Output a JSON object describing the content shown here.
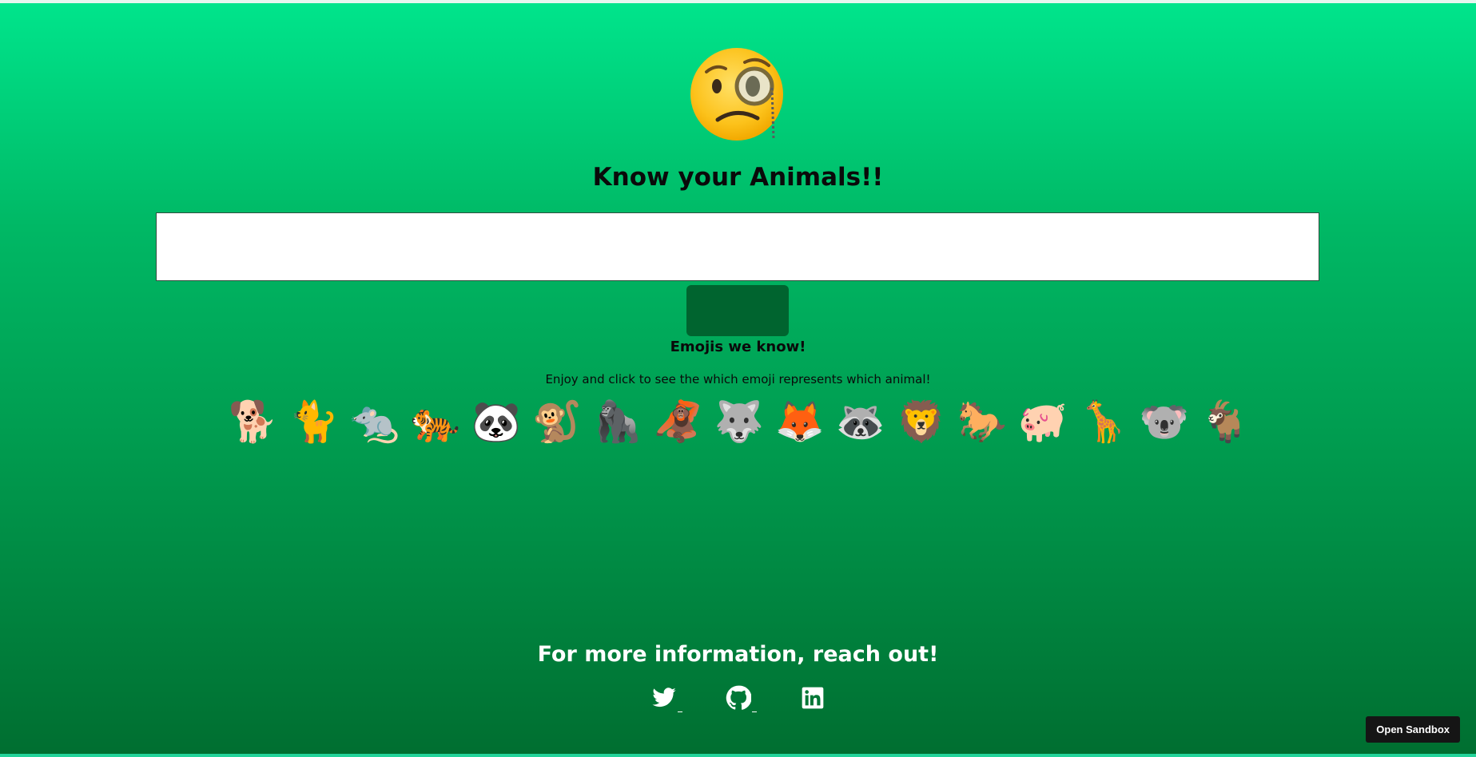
{
  "hero": {
    "emoji": "🧐",
    "icon": "face-with-monocle-icon"
  },
  "header": {
    "title": "Know your Animals!!"
  },
  "search": {
    "value": "",
    "placeholder": ""
  },
  "submit_button": {
    "label": ""
  },
  "emoji_section": {
    "heading": "Emojis we know!",
    "subtitle": "Enjoy and click to see the which emoji represents which animal!",
    "items": [
      {
        "emoji": "🐕",
        "icon": "dog-icon"
      },
      {
        "emoji": "🐈",
        "icon": "cat-icon"
      },
      {
        "emoji": "🐀",
        "icon": "rat-icon"
      },
      {
        "emoji": "🐅",
        "icon": "tiger-icon"
      },
      {
        "emoji": "🐼",
        "icon": "panda-icon"
      },
      {
        "emoji": "🐒",
        "icon": "monkey-icon"
      },
      {
        "emoji": "🦍",
        "icon": "gorilla-icon"
      },
      {
        "emoji": "🦧",
        "icon": "orangutan-icon"
      },
      {
        "emoji": "🐺",
        "icon": "wolf-icon"
      },
      {
        "emoji": "🦊",
        "icon": "fox-icon"
      },
      {
        "emoji": "🦝",
        "icon": "raccoon-icon"
      },
      {
        "emoji": "🦁",
        "icon": "lion-icon"
      },
      {
        "emoji": "🐎",
        "icon": "horse-icon"
      },
      {
        "emoji": "🐖",
        "icon": "pig-icon"
      },
      {
        "emoji": "🦒",
        "icon": "giraffe-icon"
      },
      {
        "emoji": "🐨",
        "icon": "koala-icon"
      },
      {
        "emoji": "🐐",
        "icon": "goat-icon"
      }
    ]
  },
  "footer": {
    "heading": "For more information, reach out!",
    "links": [
      {
        "icon": "twitter-icon"
      },
      {
        "icon": "github-icon"
      },
      {
        "icon": "linkedin-icon"
      }
    ]
  },
  "sandbox_button": {
    "label": "Open Sandbox"
  },
  "colors": {
    "gradient_top": "#00e58c",
    "gradient_bottom": "#006e30",
    "button_bg": "#00642f",
    "sandbox_bg": "#151515"
  }
}
